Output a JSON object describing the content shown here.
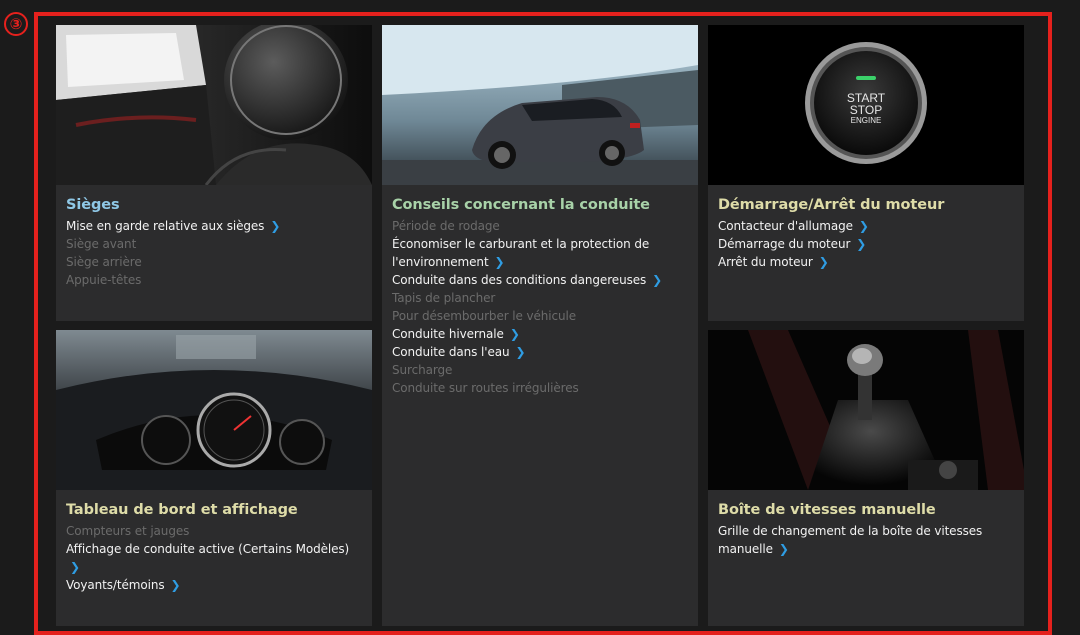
{
  "callout": "③",
  "cards": {
    "seats": {
      "title": "Sièges",
      "items": [
        {
          "label": "Mise en garde relative aux sièges",
          "link": true
        },
        {
          "label": "Siège avant",
          "link": false
        },
        {
          "label": "Siège arrière",
          "link": false
        },
        {
          "label": "Appuie-têtes",
          "link": false
        }
      ]
    },
    "driving": {
      "title": "Conseils concernant la conduite",
      "items": [
        {
          "label": "Période de rodage",
          "link": false
        },
        {
          "label": "Économiser le carburant et la protection de",
          "label2": "l'environnement",
          "link": true
        },
        {
          "label": "Conduite dans des conditions dangereuses",
          "link": true
        },
        {
          "label": "Tapis de plancher",
          "link": false
        },
        {
          "label": "Pour désembourber le véhicule",
          "link": false
        },
        {
          "label": "Conduite hivernale",
          "link": true
        },
        {
          "label": "Conduite dans l'eau",
          "link": true
        },
        {
          "label": "Surcharge",
          "link": false
        },
        {
          "label": "Conduite sur routes irrégulières",
          "link": false
        }
      ]
    },
    "engine": {
      "title": "Démarrage/Arrêt du moteur",
      "button_text": [
        "START",
        "STOP",
        "ENGINE"
      ],
      "items": [
        {
          "label": "Contacteur d'allumage",
          "link": true
        },
        {
          "label": "Démarrage du moteur",
          "link": true
        },
        {
          "label": "Arrêt du moteur",
          "link": true
        }
      ]
    },
    "dashboard": {
      "title": "Tableau de bord et affichage",
      "items": [
        {
          "label": "Compteurs et jauges",
          "link": false
        },
        {
          "label": "Affichage de conduite active (Certains Modèles)",
          "link": true,
          "chev_newline": true
        },
        {
          "label": "Voyants/témoins",
          "link": true
        }
      ]
    },
    "gearbox": {
      "title": "Boîte de vitesses manuelle",
      "items": [
        {
          "label": "Grille de changement de la boîte de vitesses",
          "label2": "manuelle",
          "link": true
        }
      ]
    }
  },
  "colors": {
    "frame": "#e5211d",
    "card_bg": "#2c2c2d",
    "chevron": "#2f9de3"
  },
  "icons": {
    "chevron": "chevron-right-icon",
    "chevron_glyph": "❯"
  }
}
